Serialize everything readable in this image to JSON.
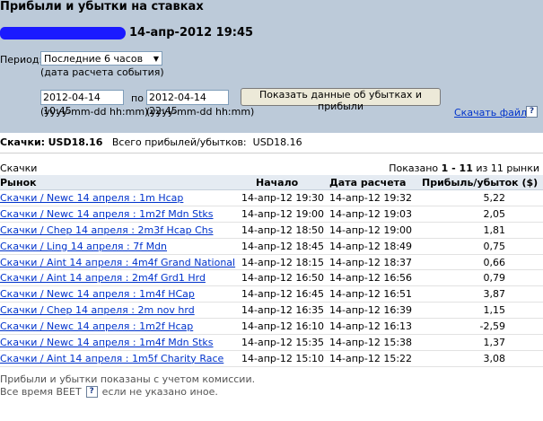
{
  "header": {
    "title": "Прибыли и убытки на ставках",
    "report_time": "14-апр-2012 19:45"
  },
  "filters": {
    "period_label": "Период:",
    "period_value": "Последние 6 часов",
    "period_hint": "(дата расчета события)",
    "date_from": "2012-04-14 10:45",
    "to_label": "по",
    "date_to": "2012-04-14 22:45",
    "format_from": "(yyyy-mm-dd hh:mm)",
    "format_to": "(yyyy-mm-dd hh:mm)",
    "show_button": "Показать данные об убытках и прибыли",
    "download_link": "Скачать файл",
    "help": "?"
  },
  "summary": {
    "category_label": "Скачки:",
    "category_amount": "USD18.16",
    "total_label": "Всего прибылей/убытков:",
    "total_amount": "USD18.16"
  },
  "list": {
    "category": "Скачки",
    "shown_prefix": "Показано",
    "shown_range": "1 - 11",
    "shown_of": "из 11 рынки"
  },
  "table": {
    "headers": [
      "Рынок",
      "Начало",
      "Дата расчета",
      "Прибыль/убыток ($)"
    ],
    "rows": [
      {
        "market": "Скачки / Newc 14 апреля : 1m Hcap",
        "start": "14-апр-12 19:30",
        "settled": "14-апр-12 19:32",
        "pl": "5,22"
      },
      {
        "market": "Скачки / Newc 14 апреля : 1m2f Mdn Stks",
        "start": "14-апр-12 19:00",
        "settled": "14-апр-12 19:03",
        "pl": "2,05"
      },
      {
        "market": "Скачки / Chep 14 апреля : 2m3f Hcap Chs",
        "start": "14-апр-12 18:50",
        "settled": "14-апр-12 19:00",
        "pl": "1,81"
      },
      {
        "market": "Скачки / Ling 14 апреля : 7f Mdn",
        "start": "14-апр-12 18:45",
        "settled": "14-апр-12 18:49",
        "pl": "0,75"
      },
      {
        "market": "Скачки / Aint 14 апреля : 4m4f Grand National",
        "start": "14-апр-12 18:15",
        "settled": "14-апр-12 18:37",
        "pl": "0,66"
      },
      {
        "market": "Скачки / Aint 14 апреля : 2m4f Grd1 Hrd",
        "start": "14-апр-12 16:50",
        "settled": "14-апр-12 16:56",
        "pl": "0,79"
      },
      {
        "market": "Скачки / Newc 14 апреля : 1m4f HCap",
        "start": "14-апр-12 16:45",
        "settled": "14-апр-12 16:51",
        "pl": "3,87"
      },
      {
        "market": "Скачки / Chep 14 апреля : 2m nov hrd",
        "start": "14-апр-12 16:35",
        "settled": "14-апр-12 16:39",
        "pl": "1,15"
      },
      {
        "market": "Скачки / Newc 14 апреля : 1m2f Hcap",
        "start": "14-апр-12 16:10",
        "settled": "14-апр-12 16:13",
        "pl": "-2,59"
      },
      {
        "market": "Скачки / Newc 14 апреля : 1m4f Mdn Stks",
        "start": "14-апр-12 15:35",
        "settled": "14-апр-12 15:38",
        "pl": "1,37"
      },
      {
        "market": "Скачки / Aint 14 апреля : 1m5f Charity Race",
        "start": "14-апр-12 15:10",
        "settled": "14-апр-12 15:22",
        "pl": "3,08"
      }
    ]
  },
  "footer": {
    "note1": "Прибыли и убытки показаны с учетом комиссии.",
    "note2_prefix": "Все время BEET",
    "note2_suffix": "если не указано иное.",
    "help": "?"
  },
  "colors": {
    "header_bg": "#bccad9",
    "table_head_bg": "#e5ebf2",
    "link": "#0033cc",
    "redaction": "#1a1aff"
  }
}
